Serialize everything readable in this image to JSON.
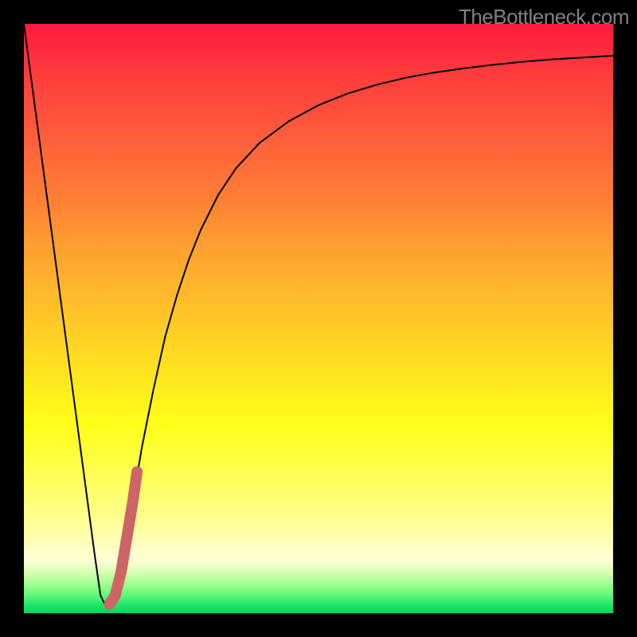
{
  "watermark": "TheBottleneck.com",
  "chart_data": {
    "type": "line",
    "title": "",
    "xlabel": "",
    "ylabel": "",
    "xlim": [
      0,
      100
    ],
    "ylim": [
      0,
      100
    ],
    "grid": false,
    "legend": false,
    "series": [
      {
        "name": "bottleneck-curve",
        "color": "#000000",
        "stroke_width": 2,
        "x": [
          0,
          2,
          4,
          6,
          8,
          10,
          12,
          13,
          14,
          15,
          16,
          18,
          20,
          22,
          24,
          26,
          28,
          30,
          33,
          36,
          40,
          45,
          50,
          55,
          60,
          65,
          70,
          75,
          80,
          85,
          90,
          95,
          100
        ],
        "y": [
          100,
          85,
          70,
          55,
          40,
          25,
          10,
          3,
          1,
          2,
          6,
          16,
          28,
          38,
          47,
          54,
          60,
          65,
          71,
          75.5,
          79.8,
          83.5,
          86.2,
          88.2,
          89.7,
          90.9,
          91.8,
          92.5,
          93.1,
          93.6,
          94.0,
          94.3,
          94.6
        ]
      },
      {
        "name": "highlight-segment",
        "color": "#cc6666",
        "stroke_width": 14,
        "linecap": "round",
        "x": [
          14.5,
          15.5,
          16.5,
          17.5,
          18.5,
          19.2
        ],
        "y": [
          1.5,
          3,
          7,
          13,
          19,
          24
        ]
      }
    ]
  }
}
